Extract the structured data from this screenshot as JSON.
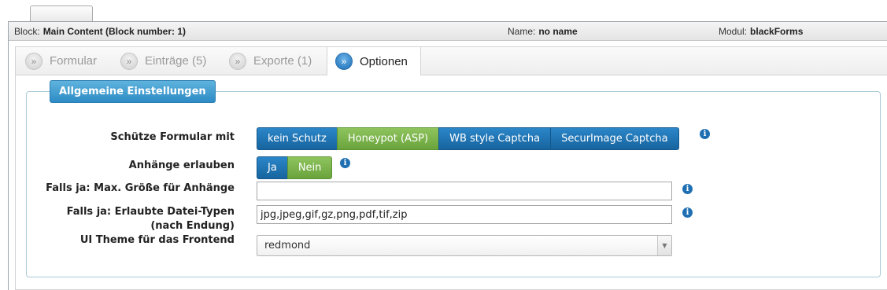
{
  "info_bar": {
    "block_label": "Block:",
    "block_value": "Main Content (Block number: 1)",
    "name_label": "Name:",
    "name_value": "no name",
    "modul_label": "Modul:",
    "modul_value": "blackForms"
  },
  "tabs": [
    {
      "label": "Formular",
      "icon": "chevron-double-right-icon",
      "active": false
    },
    {
      "label": "Einträge (5)",
      "icon": "chevron-double-right-icon",
      "active": false
    },
    {
      "label": "Exporte (1)",
      "icon": "chevron-double-right-icon",
      "active": false
    },
    {
      "label": "Optionen",
      "icon": "chevron-double-right-icon",
      "active": true
    }
  ],
  "section": {
    "legend": "Allgemeine Einstellungen",
    "protect": {
      "label": "Schütze Formular mit",
      "options": [
        "kein Schutz",
        "Honeypot (ASP)",
        "WB style Captcha",
        "SecurImage Captcha"
      ],
      "selected": "Honeypot (ASP)"
    },
    "attachments": {
      "label": "Anhänge erlauben",
      "options": [
        "Ja",
        "Nein"
      ],
      "selected": "Nein"
    },
    "max_size": {
      "label": "Falls ja: Max. Größe für Anhänge",
      "value": ""
    },
    "file_types": {
      "label_line1": "Falls ja: Erlaubte Datei-Typen",
      "label_line2": "(nach Endung)",
      "value": "jpg,jpeg,gif,gz,png,pdf,tif,zip"
    },
    "theme": {
      "label": "UI Theme für das Frontend",
      "value": "redmond"
    },
    "info_glyph": "i"
  },
  "colors": {
    "button_blue": "#1f75b8",
    "button_green": "#7db44b",
    "info_blue": "#1f6fb3",
    "legend_blue": "#3c9bd2"
  }
}
